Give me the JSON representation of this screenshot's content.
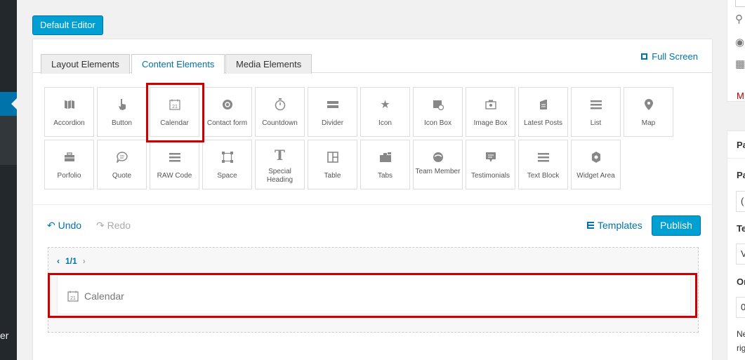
{
  "header": {
    "default_editor_label": "Default Editor"
  },
  "tabs": [
    {
      "label": "Layout Elements"
    },
    {
      "label": "Content Elements",
      "active": true
    },
    {
      "label": "Media Elements"
    }
  ],
  "full_screen_label": "Full Screen",
  "elements": [
    {
      "label": "Accordion",
      "icon": "accordion-icon"
    },
    {
      "label": "Button",
      "icon": "pointer-icon"
    },
    {
      "label": "Calendar",
      "icon": "calendar-icon"
    },
    {
      "label": "Contact form",
      "icon": "at-icon"
    },
    {
      "label": "Countdown",
      "icon": "stopwatch-icon"
    },
    {
      "label": "Divider",
      "icon": "divider-icon"
    },
    {
      "label": "Icon",
      "icon": "star-icon"
    },
    {
      "label": "Icon Box",
      "icon": "icon-box-icon"
    },
    {
      "label": "Image Box",
      "icon": "image-box-icon"
    },
    {
      "label": "Latest Posts",
      "icon": "posts-icon"
    },
    {
      "label": "List",
      "icon": "list-icon"
    },
    {
      "label": "Map",
      "icon": "map-pin-icon"
    },
    {
      "label": "Porfolio",
      "icon": "briefcase-icon"
    },
    {
      "label": "Quote",
      "icon": "quote-icon"
    },
    {
      "label": "RAW Code",
      "icon": "raw-code-icon"
    },
    {
      "label": "Space",
      "icon": "space-icon"
    },
    {
      "label": "Special Heading",
      "icon": "heading-icon"
    },
    {
      "label": "Table",
      "icon": "table-icon"
    },
    {
      "label": "Tabs",
      "icon": "tabs-icon"
    },
    {
      "label": "Team Member",
      "icon": "team-member-icon"
    },
    {
      "label": "Testimonials",
      "icon": "testimonials-icon"
    },
    {
      "label": "Text Block",
      "icon": "text-block-icon"
    },
    {
      "label": "Widget Area",
      "icon": "widget-area-icon"
    }
  ],
  "toolbar": {
    "undo_label": "Undo",
    "redo_label": "Redo",
    "templates_label": "Templates",
    "publish_label": "Publish"
  },
  "canvas": {
    "page_indicator": "1/1",
    "block_label": "Calendar",
    "calendar_day": "21"
  },
  "admin_menu_fragment": "er",
  "right_sidebar": {
    "link_fragment": "M",
    "box_title_fragment": "Pa",
    "label_parent_fragment": "Pa",
    "input_parent_fragment": "(",
    "label_template_fragment": "Te",
    "input_template_fragment": "V",
    "label_order_fragment": "Or",
    "input_order_fragment": "0",
    "note_line1": "Ne",
    "note_line2": "rig"
  },
  "colors": {
    "accent": "#0073aa",
    "button": "#00a0d2",
    "highlight": "#cc0000"
  }
}
